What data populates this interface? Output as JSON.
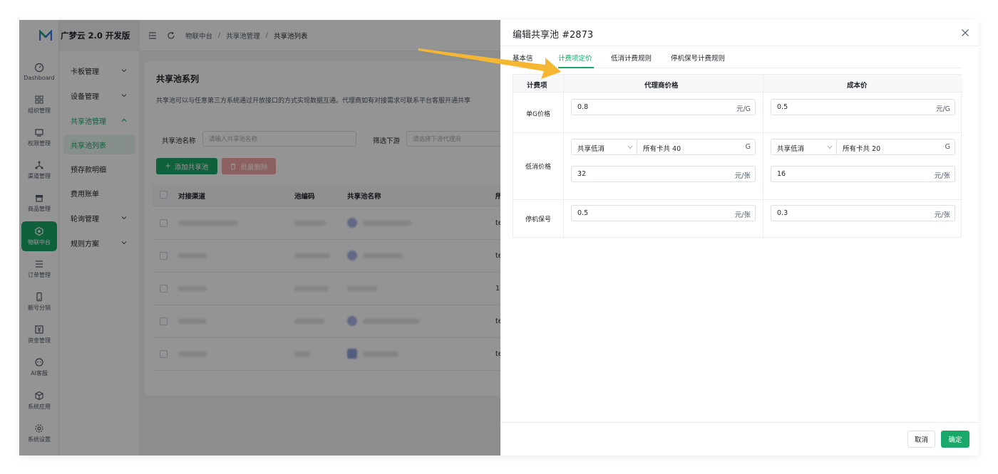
{
  "brand": {
    "name": "广梦云 2.0 开发版"
  },
  "rail": [
    {
      "label": "Dashboard",
      "icon": "dashboard-icon"
    },
    {
      "label": "组织管理",
      "icon": "grid-icon"
    },
    {
      "label": "权限管理",
      "icon": "monitor-icon"
    },
    {
      "label": "渠道管理",
      "icon": "network-icon"
    },
    {
      "label": "商品管理",
      "icon": "store-icon"
    },
    {
      "label": "物联中台",
      "icon": "iot-hub-icon"
    },
    {
      "label": "订单管理",
      "icon": "list-icon"
    },
    {
      "label": "靓号分销",
      "icon": "phone-icon"
    },
    {
      "label": "资金管理",
      "icon": "yen-icon"
    },
    {
      "label": "AI客服",
      "icon": "ai-chat-icon"
    },
    {
      "label": "系统应用",
      "icon": "cube-icon"
    },
    {
      "label": "系统设置",
      "icon": "gear-icon"
    }
  ],
  "submenu": [
    {
      "label": "卡板管理"
    },
    {
      "label": "设备管理"
    },
    {
      "label": "共享池管理"
    },
    {
      "label": "共享池列表"
    },
    {
      "label": "预存款明细"
    },
    {
      "label": "费用账单"
    },
    {
      "label": "轮询管理"
    },
    {
      "label": "规则方案"
    }
  ],
  "breadcrumb": [
    "物联中台",
    "共享池管理",
    "共享池列表"
  ],
  "main": {
    "title": "共享池系列",
    "desc": "共享池可以与任意第三方系统通过开放接口的方式实现数据互通。代理商如有对接需求可联系平台客服开通共享",
    "filter_name_label": "共享池名称",
    "filter_name_placeholder": "请输入共享池名称",
    "filter_down_label": "筛选下游",
    "filter_down_placeholder": "请选择下游代理商",
    "add_button": "添加共享池",
    "delete_button": "批量删除",
    "columns": [
      "对接渠道",
      "池编码",
      "共享池名称",
      "所"
    ],
    "row_tails": [
      "te",
      "te",
      "1!",
      "te",
      "te"
    ]
  },
  "drawer": {
    "title": "编辑共享池 #2873",
    "tabs": [
      "基本信",
      "计费项定价",
      "低消计费规则",
      "停机保号计费规则"
    ],
    "table": {
      "headers": [
        "计费项",
        "代理商价格",
        "成本价"
      ],
      "rows": {
        "unit_g": {
          "label": "单G价格",
          "agent": {
            "value": "0.8",
            "unit": "元/G"
          },
          "cost": {
            "value": "0.5",
            "unit": "元/G"
          }
        },
        "min_fee": {
          "label": "低消价格",
          "agent_select": {
            "value": "共享低消",
            "desc": "所有卡共 40",
            "unit": "G"
          },
          "cost_select": {
            "value": "共享低消",
            "desc": "所有卡共 20",
            "unit": "G"
          },
          "agent": {
            "value": "32",
            "unit": "元/张"
          },
          "cost": {
            "value": "16",
            "unit": "元/张"
          }
        },
        "suspend": {
          "label": "停机保号",
          "agent": {
            "value": "0.5",
            "unit": "元/张"
          },
          "cost": {
            "value": "0.3",
            "unit": "元/张"
          }
        }
      }
    },
    "cancel": "取消",
    "confirm": "确定"
  },
  "colors": {
    "accent": "#1aa86a",
    "danger_disabled": "#f3a5a5",
    "arrow": "#f5b731"
  }
}
